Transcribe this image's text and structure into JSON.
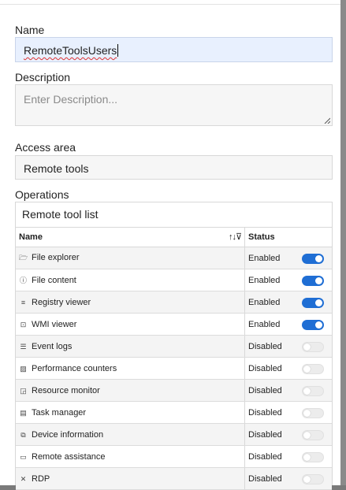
{
  "form": {
    "name_label": "Name",
    "name_value": "RemoteToolsUsers",
    "description_label": "Description",
    "description_placeholder": "Enter Description...",
    "access_label": "Access area",
    "access_value": "Remote tools",
    "operations_label": "Operations"
  },
  "table": {
    "title": "Remote tool list",
    "columns": {
      "name": "Name",
      "status": "Status"
    },
    "rows": [
      {
        "icon": "folder-icon",
        "glyph": "🗁",
        "name": "File explorer",
        "status": "Enabled",
        "on": true
      },
      {
        "icon": "info-icon",
        "glyph": "ⓘ",
        "name": "File content",
        "status": "Enabled",
        "on": true
      },
      {
        "icon": "list-icon",
        "glyph": "≡",
        "name": "Registry viewer",
        "status": "Enabled",
        "on": true
      },
      {
        "icon": "wmi-icon",
        "glyph": "⊡",
        "name": "WMI viewer",
        "status": "Enabled",
        "on": true
      },
      {
        "icon": "event-log-icon",
        "glyph": "☰",
        "name": "Event logs",
        "status": "Disabled",
        "on": false
      },
      {
        "icon": "chart-icon",
        "glyph": "▨",
        "name": "Performance counters",
        "status": "Disabled",
        "on": false
      },
      {
        "icon": "monitor-chart-icon",
        "glyph": "◲",
        "name": "Resource monitor",
        "status": "Disabled",
        "on": false
      },
      {
        "icon": "clipboard-icon",
        "glyph": "▤",
        "name": "Task manager",
        "status": "Disabled",
        "on": false
      },
      {
        "icon": "devices-icon",
        "glyph": "⧉",
        "name": "Device information",
        "status": "Disabled",
        "on": false
      },
      {
        "icon": "remote-desktop-icon",
        "glyph": "▭",
        "name": "Remote assistance",
        "status": "Disabled",
        "on": false
      },
      {
        "icon": "rdp-icon",
        "glyph": "✕",
        "name": "RDP",
        "status": "Disabled",
        "on": false
      }
    ]
  },
  "colors": {
    "accent": "#1f6ed4",
    "name_field_bg": "#e8f0fe"
  }
}
